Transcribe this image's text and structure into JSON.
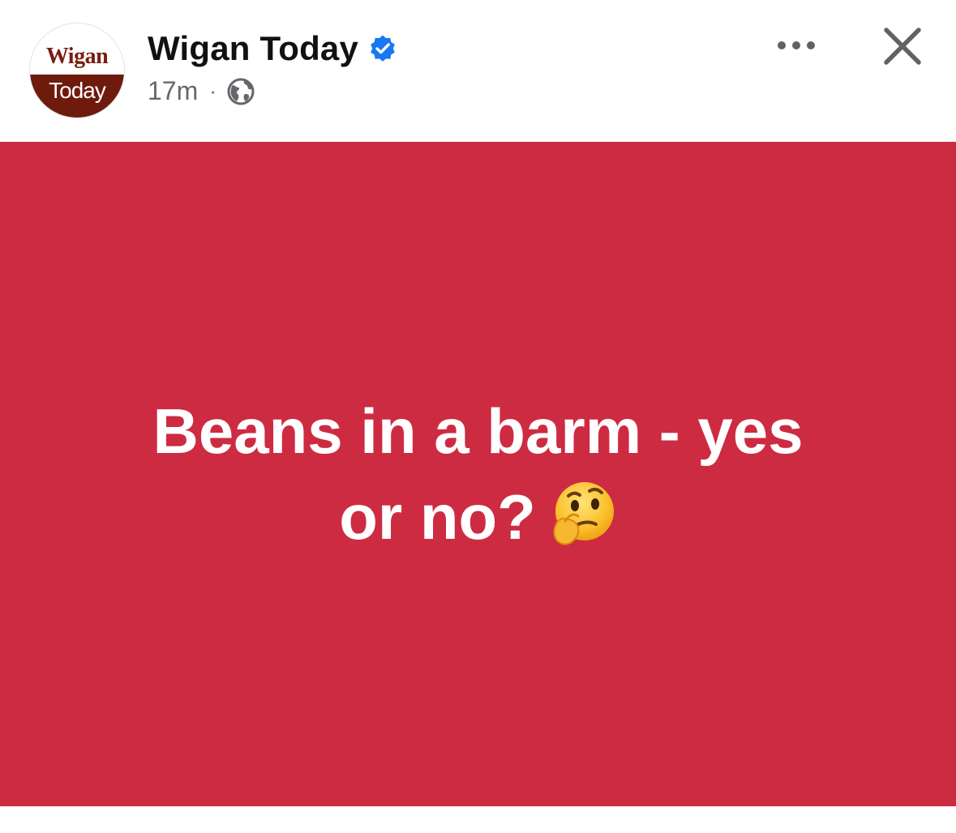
{
  "post": {
    "page_name": "Wigan Today",
    "timestamp": "17m",
    "separator": "·",
    "audience_icon": "globe-icon",
    "verified_icon": "verified-badge-icon",
    "more_icon": "more-options-icon",
    "close_icon": "close-icon",
    "avatar": {
      "top_text": "Wigan",
      "bottom_text": "Today",
      "top_color": "#ffffff",
      "bottom_color": "#6e1a0d",
      "text_color": "#7a1d12"
    }
  },
  "card": {
    "background": "#cd2b41",
    "line1": "Beans in a barm - yes",
    "line2": "or no?",
    "emoji": "thinking-face-emoji"
  },
  "colors": {
    "verified_blue": "#1877f2",
    "meta_gray": "#65676b"
  }
}
